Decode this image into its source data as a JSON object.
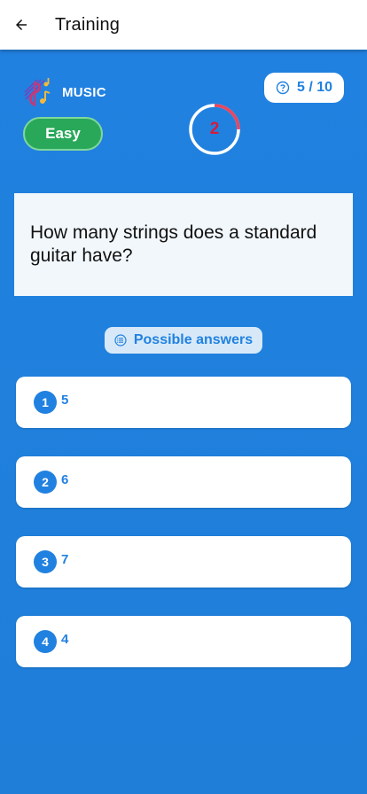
{
  "app_bar": {
    "title": "Training"
  },
  "category": {
    "label": "MUSIC",
    "icon": "music-note-icon"
  },
  "difficulty": {
    "label": "Easy",
    "color": "#29a85a"
  },
  "progress": {
    "text": "5 / 10"
  },
  "timer": {
    "value": "2",
    "ring_remaining_fraction": 0.25,
    "color": "#d61a3c"
  },
  "question": {
    "text": "How many strings does a standard guitar have?"
  },
  "answers_header": {
    "label": "Possible answers"
  },
  "answers": [
    {
      "number": "1",
      "text": "5"
    },
    {
      "number": "2",
      "text": "6"
    },
    {
      "number": "3",
      "text": "7"
    },
    {
      "number": "4",
      "text": "4"
    }
  ],
  "colors": {
    "primary": "#2181e0",
    "background": "#2181e0",
    "accent": "#d61a3c"
  }
}
